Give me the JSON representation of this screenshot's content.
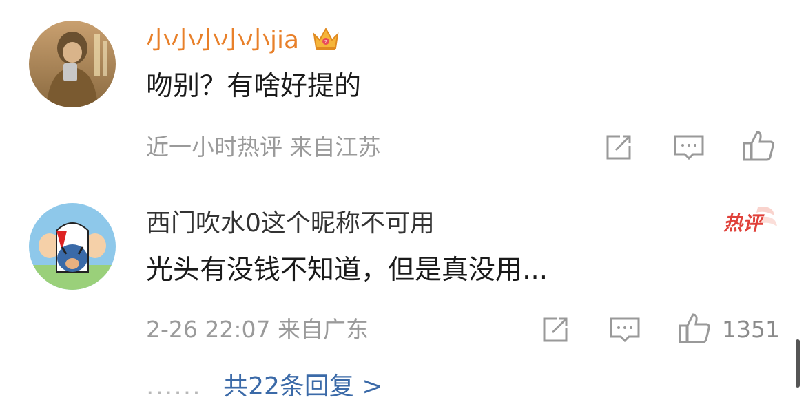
{
  "comments": [
    {
      "username": "小小小小小jia",
      "username_color": "#e8802a",
      "badge_icon": "crown-icon",
      "text": "吻别？有啥好提的",
      "meta": "近一小时热评  来自江苏",
      "actions": [
        "share-icon",
        "comment-icon",
        "like-icon"
      ],
      "like_count": ""
    },
    {
      "username": "西门吹水0这个昵称不可用",
      "username_color": "#333333",
      "hot_label": "热评",
      "text": "光头有没钱不知道，但是真没用...",
      "meta": "2-26 22:07  来自广东",
      "actions": [
        "share-icon",
        "comment-icon",
        "like-icon"
      ],
      "like_count": "1351"
    }
  ],
  "replies_link": "共22条回复 >",
  "replies_prefix": "......",
  "colors": {
    "link": "#3b6aa8",
    "meta": "#9a9a9a",
    "hot": "#e0413a"
  }
}
